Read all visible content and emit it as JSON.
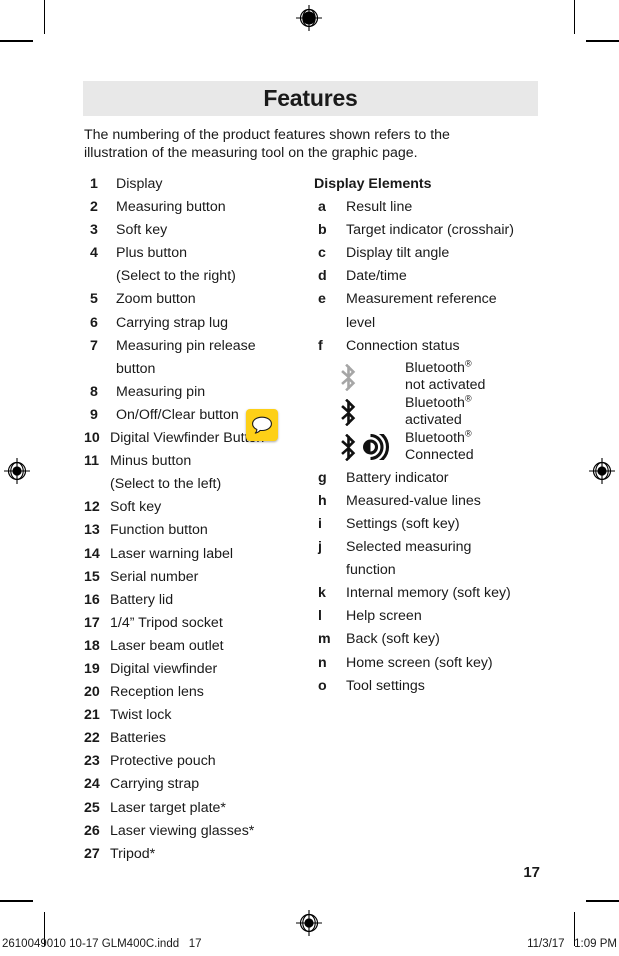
{
  "header": {
    "title": "Features"
  },
  "intro": {
    "line1": "The numbering of the product features shown refers to the",
    "line2": "illustration of the measuring tool on the graphic page."
  },
  "product_features": [
    {
      "key": "1",
      "label": "Display"
    },
    {
      "key": "2",
      "label": "Measuring button"
    },
    {
      "key": "3",
      "label": "Soft key"
    },
    {
      "key": "4",
      "label": "Plus button",
      "sub": "(Select to the right)"
    },
    {
      "key": "5",
      "label": "Zoom button"
    },
    {
      "key": "6",
      "label": "Carrying strap lug"
    },
    {
      "key": "7",
      "label": "Measuring pin release",
      "sub": "button"
    },
    {
      "key": "8",
      "label": "Measuring pin"
    },
    {
      "key": "9",
      "label": "On/Off/Clear button"
    },
    {
      "key": "10",
      "label": "Digital Viewfinder Button"
    },
    {
      "key": "11",
      "label": "Minus button",
      "sub": "(Select to the left)"
    },
    {
      "key": "12",
      "label": "Soft key"
    },
    {
      "key": "13",
      "label": "Function button"
    },
    {
      "key": "14",
      "label": "Laser warning label"
    },
    {
      "key": "15",
      "label": "Serial number"
    },
    {
      "key": "16",
      "label": "Battery lid"
    },
    {
      "key": "17",
      "label": "1/4” Tripod socket"
    },
    {
      "key": "18",
      "label": "Laser beam outlet"
    },
    {
      "key": "19",
      "label": "Digital viewfinder"
    },
    {
      "key": "20",
      "label": "Reception lens"
    },
    {
      "key": "21",
      "label": "Twist lock"
    },
    {
      "key": "22",
      "label": "Batteries"
    },
    {
      "key": "23",
      "label": "Protective pouch"
    },
    {
      "key": "24",
      "label": "Carrying strap"
    },
    {
      "key": "25",
      "label": "Laser target plate*"
    },
    {
      "key": "26",
      "label": "Laser viewing glasses*"
    },
    {
      "key": "27",
      "label": "Tripod*"
    }
  ],
  "display_elements": {
    "title": "Display Elements",
    "items_before_bluetooth": [
      {
        "key": "a",
        "label": "Result line"
      },
      {
        "key": "b",
        "label": "Target indicator (crosshair)"
      },
      {
        "key": "c",
        "label": "Display tilt angle"
      },
      {
        "key": "d",
        "label": "Date/time"
      },
      {
        "key": "e",
        "label": "Measurement reference",
        "sub": "level"
      },
      {
        "key": "f",
        "label": "Connection status"
      }
    ],
    "bluetooth_states": [
      {
        "icon": "bluetooth-inactive-icon",
        "brand": "Bluetooth",
        "trademark": "®",
        "status": "not activated",
        "color": "#a6a6a6",
        "waves": false
      },
      {
        "icon": "bluetooth-active-icon",
        "brand": "Bluetooth",
        "trademark": "®",
        "status": "activated",
        "color": "#111111",
        "waves": false
      },
      {
        "icon": "bluetooth-connected-icon",
        "brand": "Bluetooth",
        "trademark": "®",
        "status": "Connected",
        "color": "#111111",
        "waves": true
      }
    ],
    "items_after_bluetooth": [
      {
        "key": "g",
        "label": "Battery indicator"
      },
      {
        "key": "h",
        "label": "Measured-value lines"
      },
      {
        "key": "i",
        "label": "Settings (soft key)"
      },
      {
        "key": "j",
        "label": "Selected measuring",
        "sub": "function"
      },
      {
        "key": "k",
        "label": "Internal memory (soft key)"
      },
      {
        "key": "l",
        "label": "Help screen"
      },
      {
        "key": "m",
        "label": "Back (soft key)"
      },
      {
        "key": "n",
        "label": "Home screen (soft key)"
      },
      {
        "key": "o",
        "label": "Tool settings"
      }
    ]
  },
  "annotation": {
    "type": "comment-note",
    "color": "#fdd017"
  },
  "page_number": "17",
  "footer": {
    "left": "2610049010 10-17 GLM400C.indd   17",
    "right": "11/3/17   1:09 PM"
  }
}
